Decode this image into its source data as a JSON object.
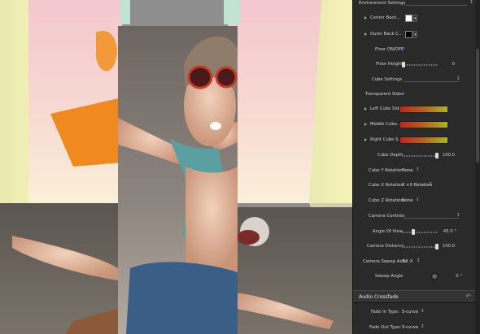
{
  "inspector": {
    "env_settings": "Environment Settings",
    "center_back": "Center Back...",
    "outer_back": "Outer Back C...",
    "floor_onoff": "Floor ON/OFF",
    "floor_height": "Floor Height",
    "floor_height_value": "0",
    "cube_settings": "Cube Settings",
    "transparent_sides": "Transparent Sides",
    "left_cube_sides": "Left Cube Sides",
    "middle_cube": "Middle Cube...",
    "right_cube": "Right Cube S...",
    "cube_depth": "Cube Depth",
    "cube_depth_value": "100.0",
    "cube_y_rotation": "Cube Y Rotation",
    "cube_y_rotation_value": "None",
    "cube_x_rotation": "Cube X Rotation",
    "cube_x_rotation_value": "2 ×X Rotation",
    "cube_z_rotation": "Cube Z Rotation",
    "cube_z_rotation_value": "None",
    "camera_controls": "Camera Controls",
    "angle_of_view": "Angle Of View",
    "angle_of_view_value": "45.0 °",
    "camera_distance": "Camera Distance",
    "camera_distance_value": "100.0",
    "camera_sweep_axis": "Camera Sweep Axis",
    "camera_sweep_axis_value": "Tilt X",
    "sweep_angle": "Sweep Angle",
    "sweep_angle_value": "0 °",
    "audio_crossfade": "Audio Crossfade",
    "fade_in_type": "Fade In Type:",
    "fade_in_type_value": "S-curve",
    "fade_out_type": "Fade Out Type:",
    "fade_out_type_value": "S-curve"
  },
  "colors": {
    "center_back_swatch": "#ffffff",
    "outer_back_swatch": "#000000",
    "checkbox": "#3d8cff"
  }
}
